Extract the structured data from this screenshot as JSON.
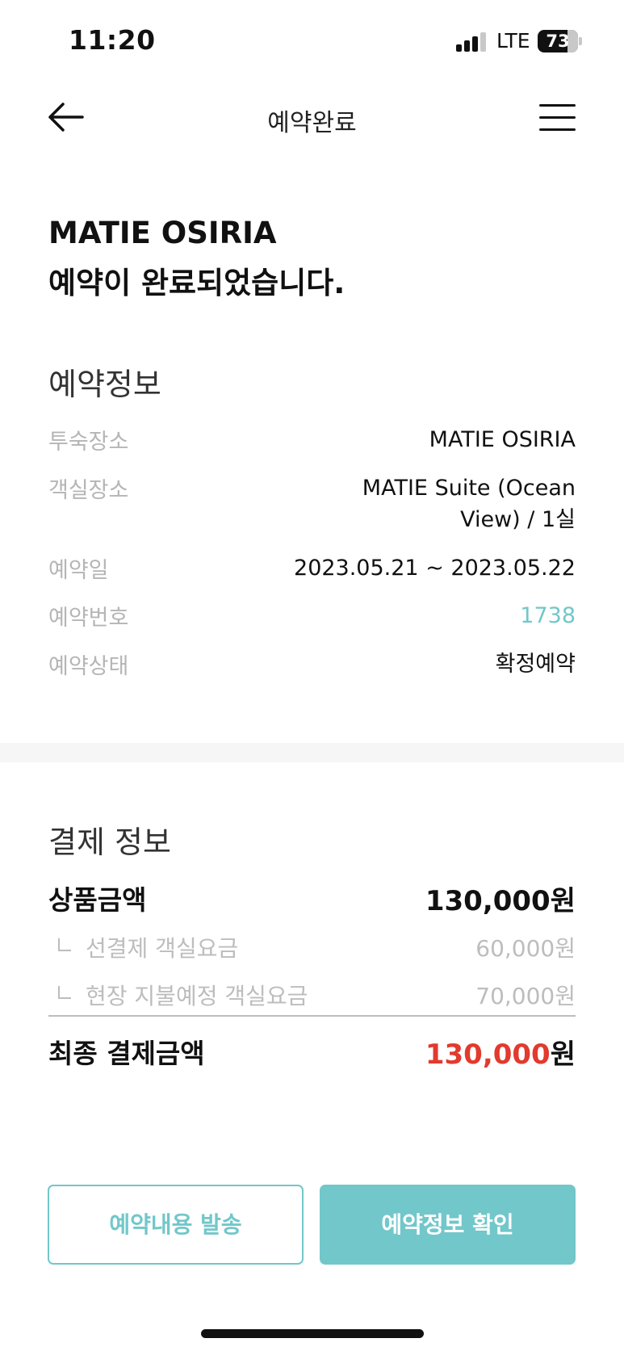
{
  "status_bar": {
    "time": "11:20",
    "network": "LTE",
    "battery": "73"
  },
  "nav": {
    "title": "예약완료",
    "back_icon": "arrow-left-icon",
    "menu_icon": "hamburger-menu-icon"
  },
  "headline": {
    "line1": "MATIE OSIRIA",
    "line2": "예약이 완료되었습니다."
  },
  "reservation": {
    "title": "예약정보",
    "rows": [
      {
        "label": "투숙장소",
        "value": "MATIE OSIRIA"
      },
      {
        "label": "객실장소",
        "value_line1": "MATIE Suite (Ocean",
        "value_line2": "View) / 1실"
      },
      {
        "label": "예약일",
        "value": "2023.05.21 ~ 2023.05.22"
      },
      {
        "label": "예약번호",
        "value": "1738"
      },
      {
        "label": "예약상태",
        "value": "확정예약"
      }
    ]
  },
  "payment": {
    "title": "결제 정보",
    "product_label": "상품금액",
    "product_value": "130,000원",
    "prepaid_label": "선결제 객실요금",
    "prepaid_value": "60,000원",
    "onsite_label": "현장 지불예정 객실요금",
    "onsite_value": "70,000원",
    "final_label": "최종 결제금액",
    "final_amount": "130,000",
    "final_unit": "원"
  },
  "buttons": {
    "send_label": "예약내용 발송",
    "check_label": "예약정보 확인"
  },
  "colors": {
    "accent": "#72c7ca",
    "final_price": "#e23a2e"
  }
}
